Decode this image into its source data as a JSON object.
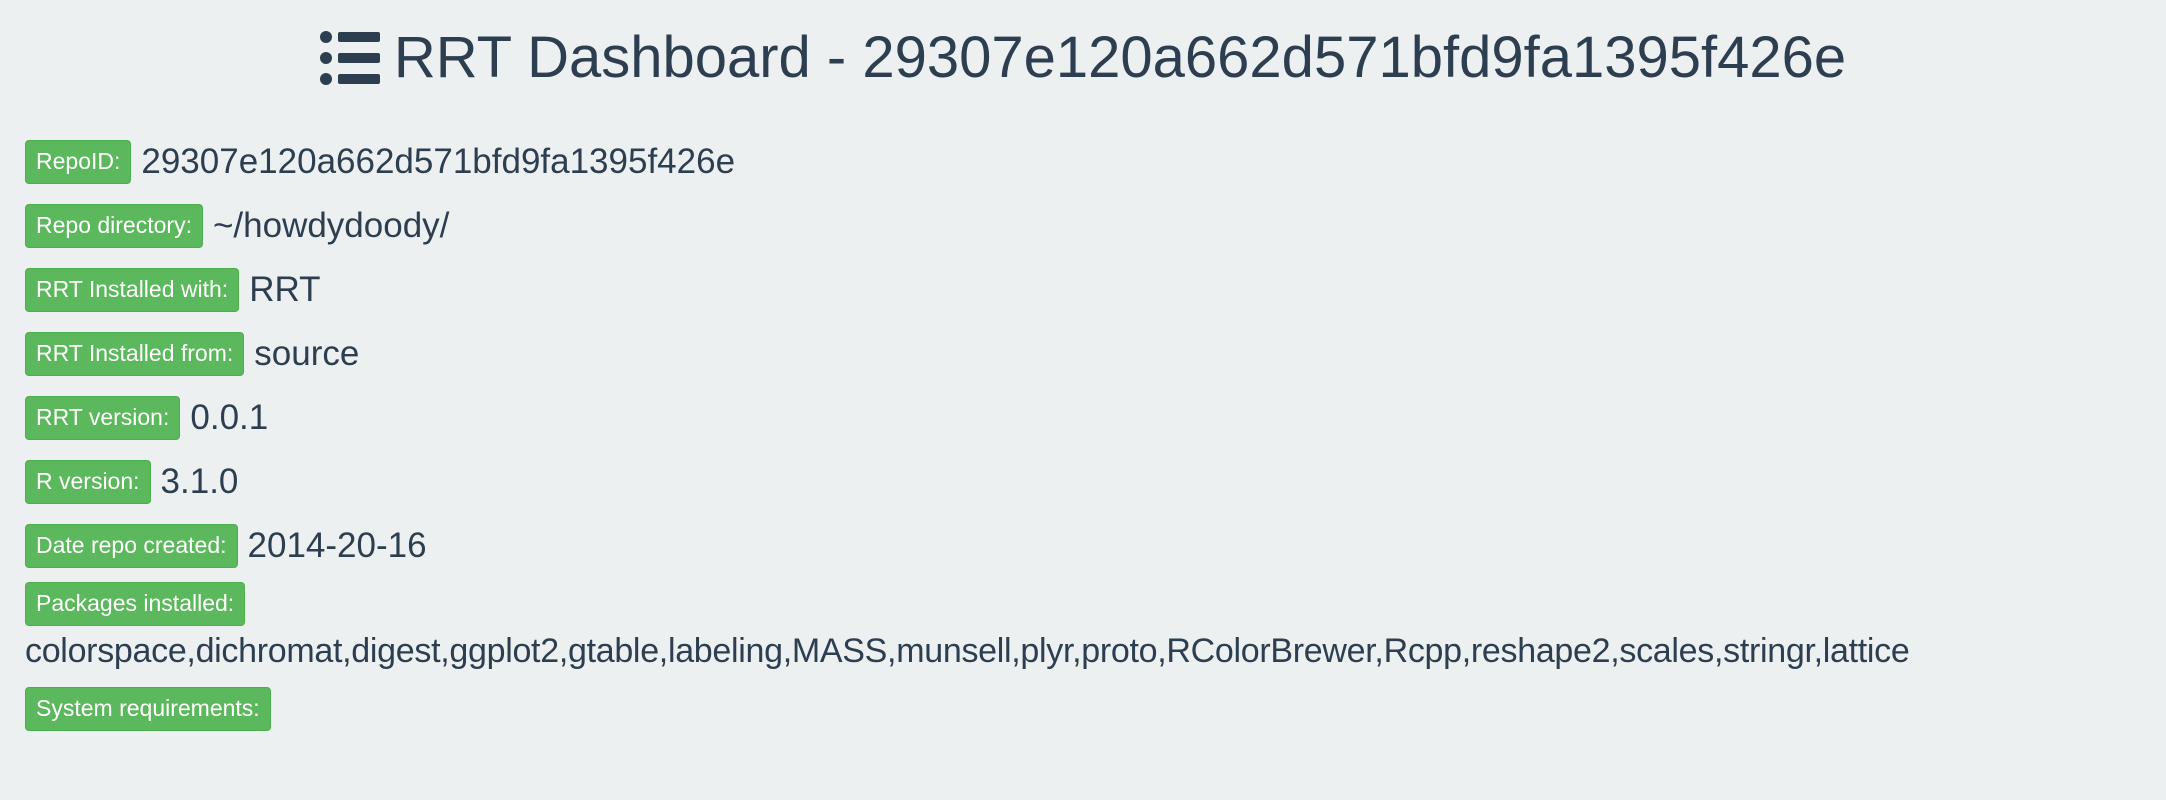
{
  "header": {
    "icon": "list-icon",
    "title": "RRT Dashboard - 29307e120a662d571bfd9fa1395f426e"
  },
  "fields": {
    "repo_id": {
      "label": "RepoID:",
      "value": "29307e120a662d571bfd9fa1395f426e"
    },
    "repo_directory": {
      "label": "Repo directory:",
      "value": "~/howdydoody/"
    },
    "installed_with": {
      "label": "RRT Installed with:",
      "value": "RRT"
    },
    "installed_from": {
      "label": "RRT Installed from:",
      "value": "source"
    },
    "rrt_version": {
      "label": "RRT version:",
      "value": "0.0.1"
    },
    "r_version": {
      "label": "R version:",
      "value": "3.1.0"
    },
    "date_created": {
      "label": "Date repo created:",
      "value": "2014-20-16"
    },
    "packages": {
      "label": "Packages installed:",
      "value": "colorspace,dichromat,digest,ggplot2,gtable,labeling,MASS,munsell,plyr,proto,RColorBrewer,Rcpp,reshape2,scales,stringr,lattice"
    },
    "system_requirements": {
      "label": "System requirements:",
      "value": ""
    }
  },
  "colors": {
    "label_bg": "#5cb85c",
    "page_bg": "#ecf0f1",
    "text": "#2c3e50"
  }
}
